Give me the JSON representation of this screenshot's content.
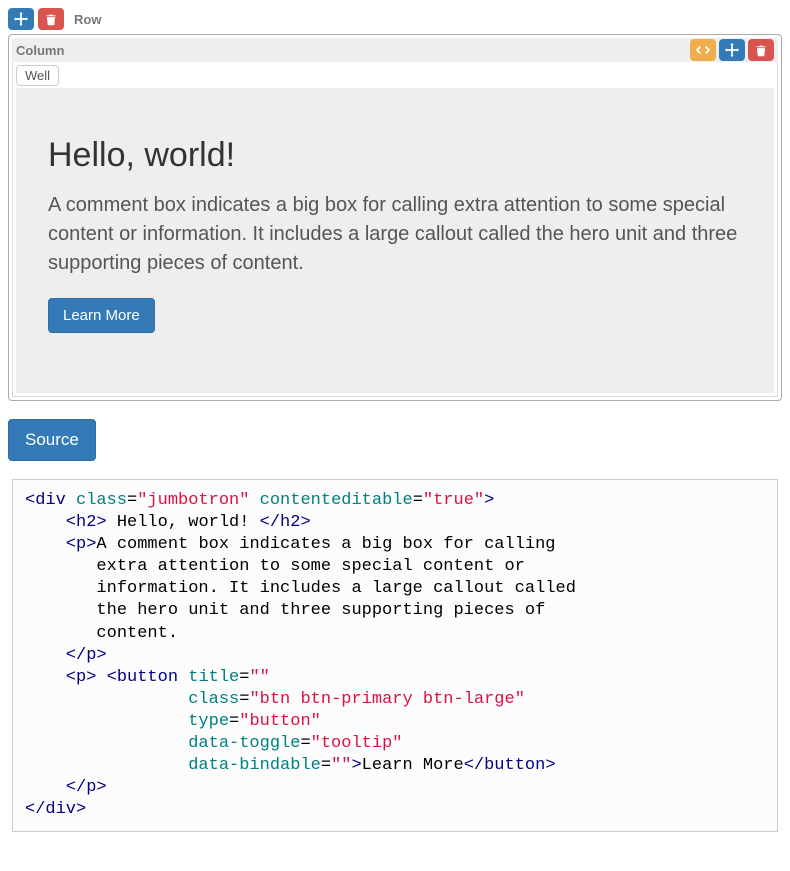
{
  "toolbar": {
    "row_label": "Row"
  },
  "column": {
    "label": "Column",
    "well_tag": "Well"
  },
  "jumbotron": {
    "heading": "Hello, world!",
    "paragraph": "A comment box indicates a big box for calling extra attention to some special content or information. It includes a large callout called the hero unit and three supporting pieces of content.",
    "button_label": "Learn More"
  },
  "source_button": "Source",
  "code": {
    "line1_open": "<div",
    "line1_attr1": " class",
    "line1_eq": "=",
    "line1_val1": "\"jumbotron\"",
    "line1_attr2": " contenteditable",
    "line1_val2": "\"true\"",
    "line1_close": ">",
    "line2_open": "    <h2>",
    "line2_txt": " Hello, world! ",
    "line2_close": "</h2>",
    "line3_open": "    <p>",
    "line3_txt": "A comment box indicates a big box for calling\n       extra attention to some special content or\n       information. It includes a large callout called\n       the hero unit and three supporting pieces of\n       content.",
    "line4": "    </p>",
    "line5_open": "    <p>",
    "line5_sp": " ",
    "line5_btn": "<button",
    "line5_attr_title": " title",
    "line5_val_title": "\"\"",
    "line6_attr": "                class",
    "line6_val": "\"btn btn-primary btn-large\"",
    "line7_attr": "                type",
    "line7_val": "\"button\"",
    "line8_attr": "                data-toggle",
    "line8_val": "\"tooltip\"",
    "line9_attr": "                data-bindable",
    "line9_val": "\"\"",
    "line9_close": ">",
    "line9_txt": "Learn More",
    "line9_btn_close": "</button>",
    "line10": "    </p>",
    "line11": "</div>"
  }
}
